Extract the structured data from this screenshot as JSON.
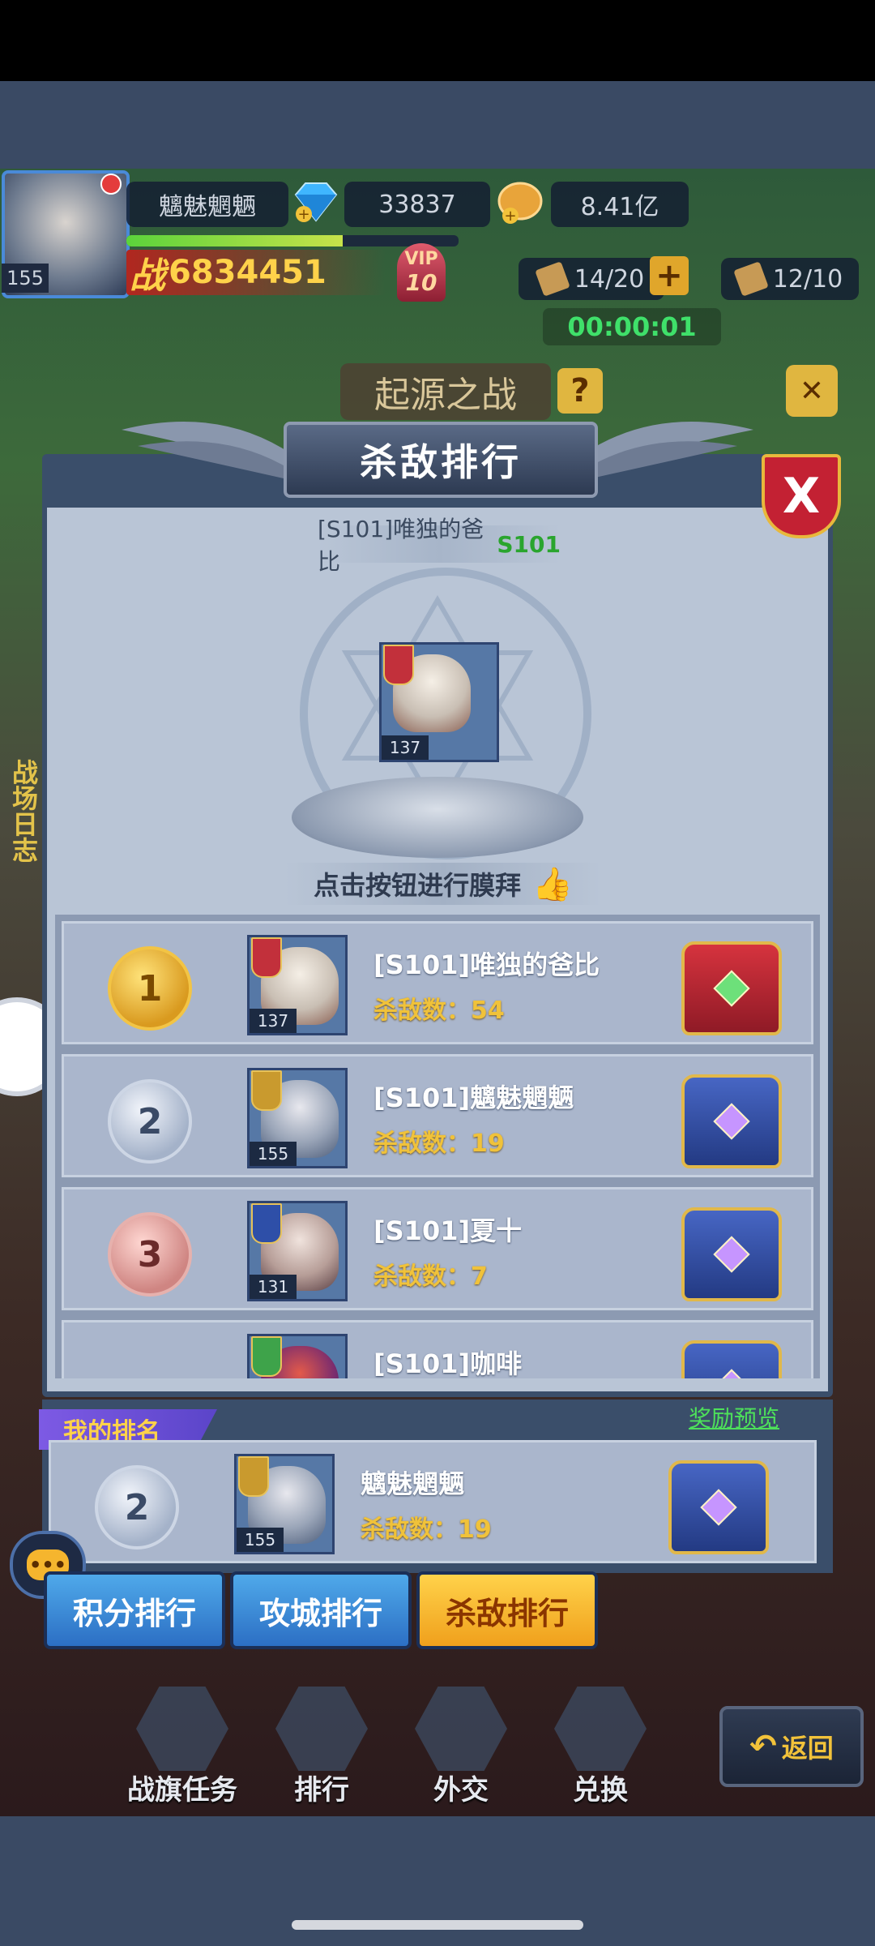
{
  "hud": {
    "player_name": "魑魅魍魉",
    "level": "155",
    "gems": "33837",
    "gold": "8.41亿",
    "power_label": "战",
    "power": "6834451",
    "vip_label": "VIP",
    "vip_level": "10",
    "stamina_a": "14/20",
    "stamina_b": "12/10",
    "timer": "00:00:01",
    "battle_name": "起源之战",
    "help": "?"
  },
  "side": {
    "battle_log": "战场日志"
  },
  "panel": {
    "title": "杀敌排行",
    "close": "X",
    "champion_name": "[S101]唯独的爸比",
    "champion_server": "S101",
    "champion_level": "137",
    "worship_text": "点击按钮进行膜拜",
    "thumb_icon": "thumbs-up",
    "rows": [
      {
        "rank": "1",
        "name": "[S101]唯独的爸比",
        "kills": "杀敌数：54",
        "level": "137",
        "chest": "red"
      },
      {
        "rank": "2",
        "name": "[S101]魑魅魍魉",
        "kills": "杀敌数：19",
        "level": "155",
        "chest": "blue"
      },
      {
        "rank": "3",
        "name": "[S101]夏十",
        "kills": "杀敌数：7",
        "level": "131",
        "chest": "blue"
      },
      {
        "rank": "",
        "name": "[S101]咖啡",
        "kills": "",
        "level": "",
        "chest": "blue"
      }
    ],
    "my_rank_label": "我的排名",
    "reward_preview": "奖励预览",
    "my_row": {
      "rank": "2",
      "name": "魑魅魍魉",
      "kills": "杀敌数：19",
      "level": "155"
    }
  },
  "tabs": {
    "points": "积分排行",
    "siege": "攻城排行",
    "kills": "杀敌排行"
  },
  "bottom_nav": {
    "flag_tasks": "战旗任务",
    "ranking": "排行",
    "diplomacy": "外交",
    "exchange": "兑换",
    "back": "返回"
  },
  "colors": {
    "panel_bg": "#b9c5d6",
    "active_tab": "#f0a01c",
    "inactive_tab": "#2c6fc4",
    "kill_text": "#f0c23a",
    "server_green": "#2aa52e"
  }
}
